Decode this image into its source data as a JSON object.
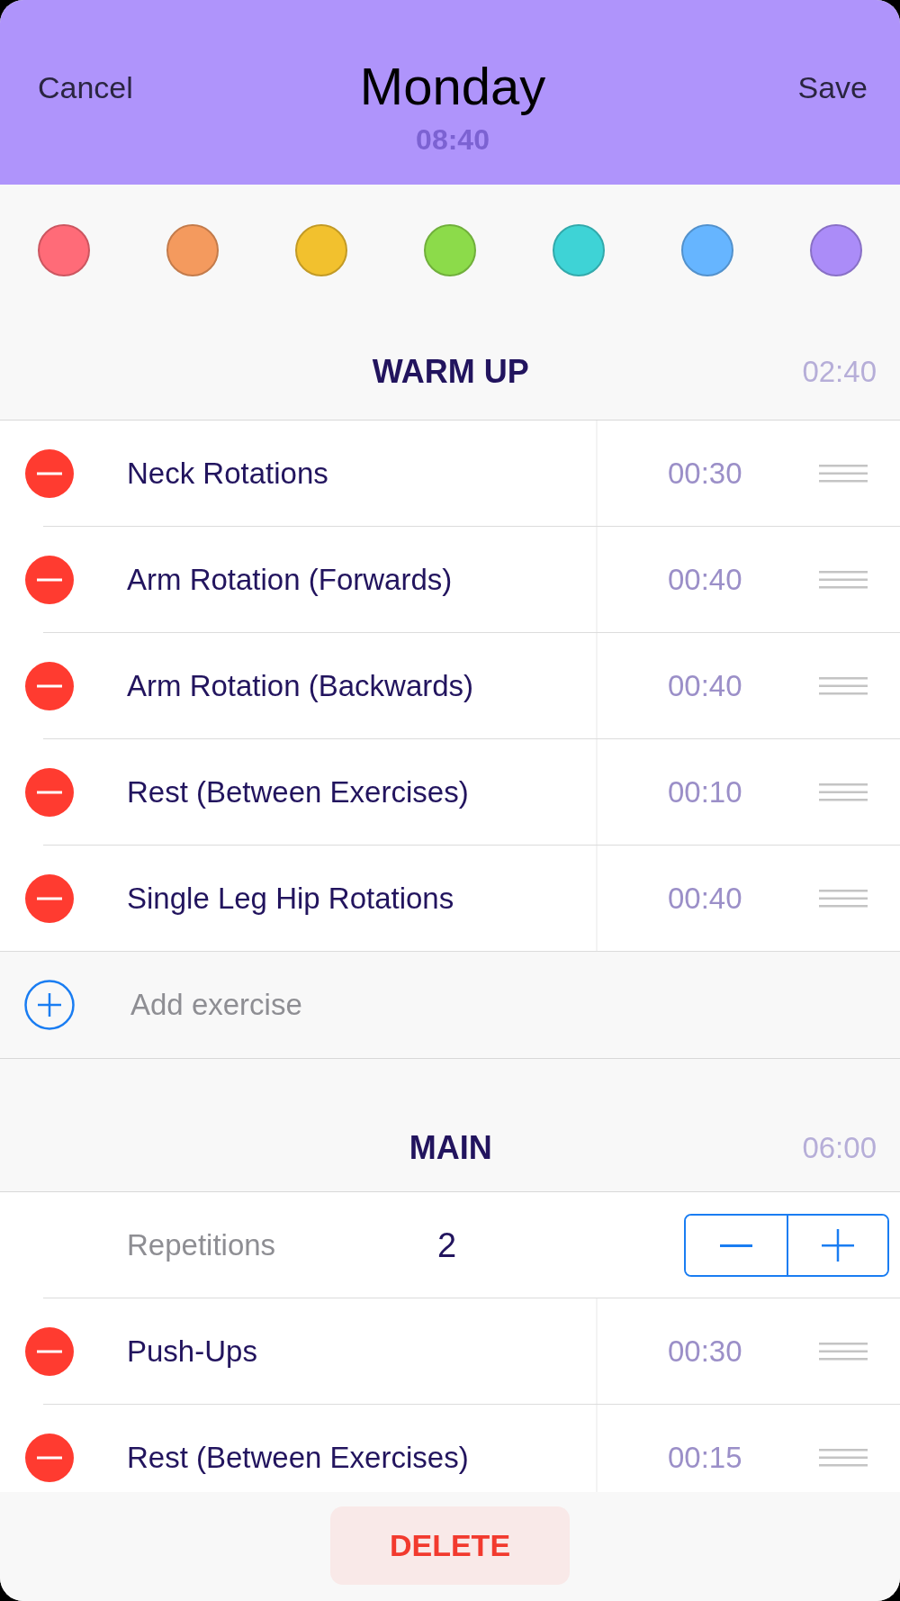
{
  "header": {
    "cancel": "Cancel",
    "title": "Monday",
    "duration": "08:40",
    "save": "Save"
  },
  "colors": [
    {
      "color": "#ff6b78"
    },
    {
      "color": "#f49a5e"
    },
    {
      "color": "#f2c12e"
    },
    {
      "color": "#8cdb4a"
    },
    {
      "color": "#3ed3d6"
    },
    {
      "color": "#66b5ff"
    },
    {
      "color": "#ab8cf8"
    }
  ],
  "sections": [
    {
      "title": "WARM UP",
      "duration": "02:40",
      "exercises": [
        {
          "name": "Neck Rotations",
          "duration": "00:30"
        },
        {
          "name": "Arm Rotation (Forwards)",
          "duration": "00:40"
        },
        {
          "name": "Arm Rotation (Backwards)",
          "duration": "00:40"
        },
        {
          "name": "Rest (Between Exercises)",
          "duration": "00:10"
        },
        {
          "name": "Single Leg Hip Rotations",
          "duration": "00:40"
        }
      ],
      "add_label": "Add exercise"
    },
    {
      "title": "MAIN",
      "duration": "06:00",
      "repetitions": {
        "label": "Repetitions",
        "value": "2"
      },
      "exercises": [
        {
          "name": "Push-Ups",
          "duration": "00:30"
        },
        {
          "name": "Rest (Between Exercises)",
          "duration": "00:15"
        }
      ]
    }
  ],
  "delete_button": "DELETE"
}
